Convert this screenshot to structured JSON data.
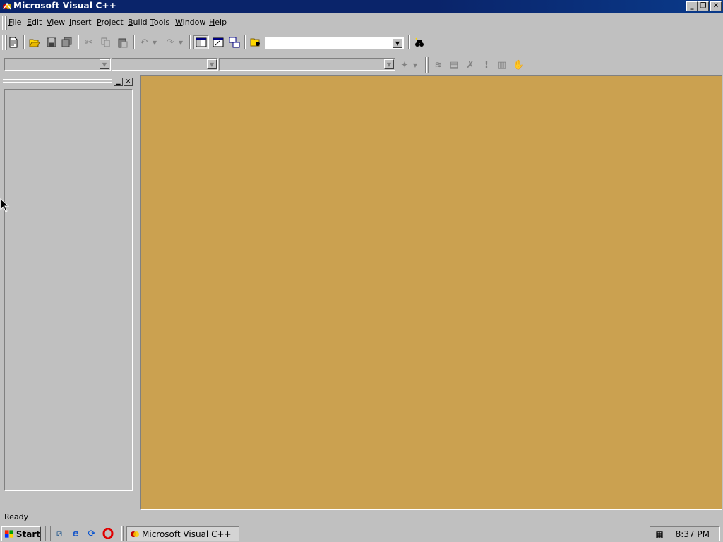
{
  "window": {
    "title": "Microsoft Visual C++",
    "buttons": [
      "minimize",
      "restore",
      "close"
    ]
  },
  "menubar": {
    "items": [
      {
        "label": "File",
        "hotkey": "F"
      },
      {
        "label": "Edit",
        "hotkey": "E"
      },
      {
        "label": "View",
        "hotkey": "V"
      },
      {
        "label": "Insert",
        "hotkey": "I"
      },
      {
        "label": "Project",
        "hotkey": "P"
      },
      {
        "label": "Build",
        "hotkey": "B"
      },
      {
        "label": "Tools",
        "hotkey": "T"
      },
      {
        "label": "Window",
        "hotkey": "W"
      },
      {
        "label": "Help",
        "hotkey": "H"
      }
    ]
  },
  "toolbar_standard": {
    "buttons": [
      "new-text-file",
      "open",
      "save",
      "save-all",
      "cut",
      "copy",
      "paste",
      "undo",
      "redo",
      "workspace",
      "output",
      "window-list",
      "find-in-files",
      "find"
    ],
    "find_combo_value": ""
  },
  "toolbar_wizardbar": {
    "combos": [
      "",
      "",
      ""
    ],
    "buttons": [
      "wizard-actions",
      "compile",
      "build",
      "stop-build",
      "execute",
      "go",
      "insert-remove-breakpoint"
    ]
  },
  "workspace": {
    "visible": true
  },
  "mdi": {
    "background_color": "#cba150"
  },
  "statusbar": {
    "text": "Ready"
  },
  "taskbar": {
    "start_label": "Start",
    "quick_launch": [
      "show-desktop",
      "internet-explorer",
      "channels",
      "opera"
    ],
    "tasks": [
      {
        "label": "Microsoft Visual C++"
      }
    ],
    "clock": "8:37 PM"
  }
}
